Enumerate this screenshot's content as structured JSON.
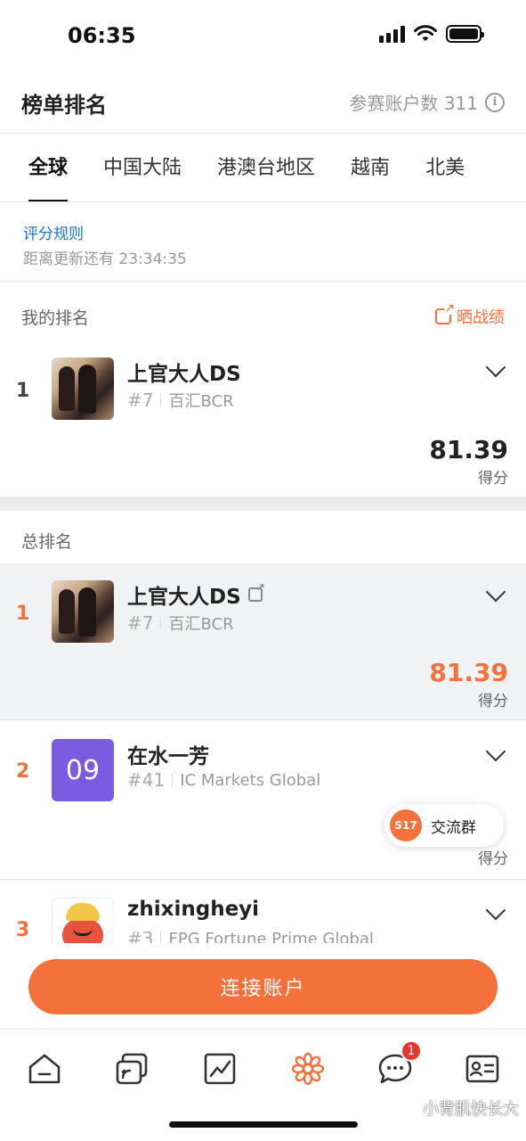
{
  "status_bar": {
    "time": "06:35"
  },
  "header": {
    "title": "榜单排名",
    "participants_label": "参赛账户数 311"
  },
  "tabs": [
    {
      "label": "全球",
      "active": true
    },
    {
      "label": "中国大陆",
      "active": false
    },
    {
      "label": "港澳台地区",
      "active": false
    },
    {
      "label": "越南",
      "active": false
    },
    {
      "label": "北美",
      "active": false
    }
  ],
  "rules": {
    "link": "评分规则",
    "countdown": "距离更新还有 23:34:35"
  },
  "my_rank": {
    "label": "我的排名",
    "share": "晒战绩",
    "entry": {
      "rank": "1",
      "name": "上官大人DS",
      "tag": "#7",
      "broker": "百汇BCR",
      "score": "81.39",
      "score_label": "得分"
    }
  },
  "total_rank": {
    "label": "总排名",
    "entries": [
      {
        "rank": "1",
        "name": "上官大人DS",
        "tag": "#7",
        "broker": "百汇BCR",
        "score": "81.39",
        "score_label": "得分"
      },
      {
        "rank": "2",
        "name": "在水一芳",
        "avatar_text": "09",
        "tag": "#41",
        "broker": "IC Markets Global",
        "score": "",
        "score_label": "得分"
      },
      {
        "rank": "3",
        "name": "zhixingheyi",
        "tag": "#3",
        "broker": "FPG Fortune Prime Global"
      }
    ]
  },
  "chat_pill": {
    "logo": "S17",
    "label": "交流群"
  },
  "connect_button": "连接账户",
  "bottom_nav": {
    "items": [
      "home-icon",
      "feed-icon",
      "chart-icon",
      "brand-icon",
      "chat-icon",
      "profile-icon"
    ],
    "chat_badge": "1"
  },
  "watermark": "小背肌快长大",
  "colors": {
    "accent": "#f4713b",
    "link": "#1a73c9",
    "avatar_purple": "#7b5ce0",
    "badge": "#e8342e"
  }
}
